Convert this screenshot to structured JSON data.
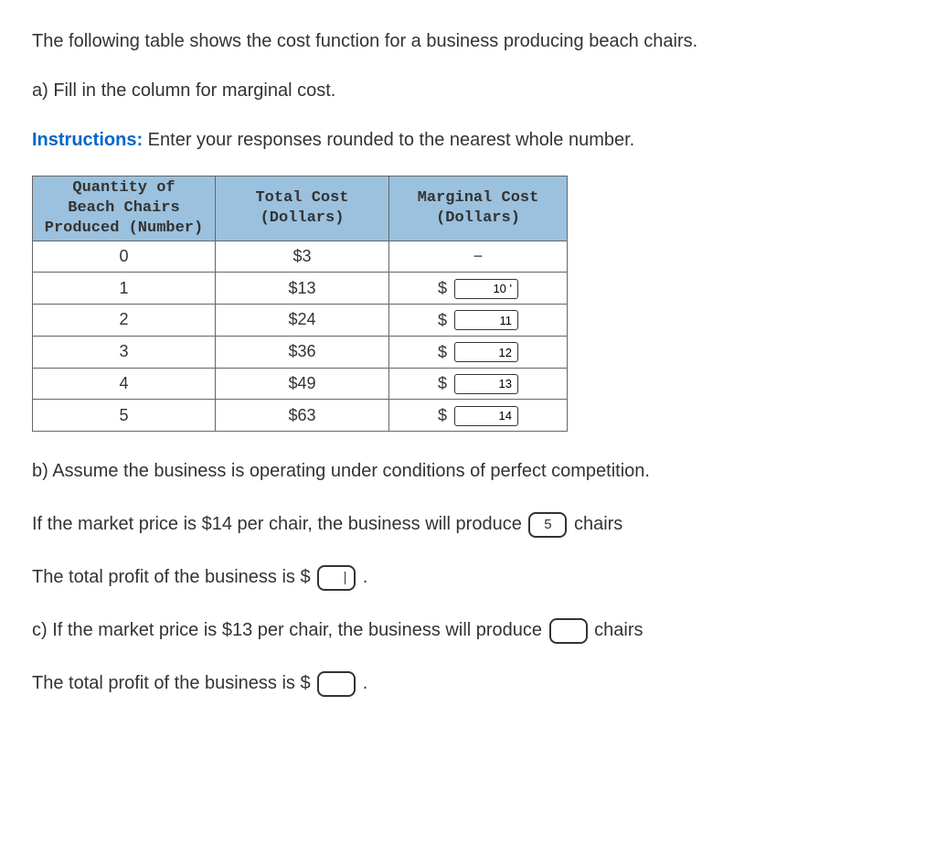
{
  "q_intro": "The following table shows the cost function for a business producing beach chairs.",
  "q_a": "a) Fill in the column for marginal cost.",
  "instr_label": "Instructions:",
  "instr_text": " Enter your responses rounded to the nearest whole number.",
  "table": {
    "headers": {
      "col1": "Quantity of\nBeach Chairs\nProduced (Number)",
      "col2": "Total Cost\n(Dollars)",
      "col3": "Marginal Cost\n(Dollars)"
    },
    "rows": [
      {
        "qty": "0",
        "tc": "$3",
        "mc_dash": "−",
        "mc_input": null
      },
      {
        "qty": "1",
        "tc": "$13",
        "mc_input": "10 '"
      },
      {
        "qty": "2",
        "tc": "$24",
        "mc_input": "11"
      },
      {
        "qty": "3",
        "tc": "$36",
        "mc_input": "12"
      },
      {
        "qty": "4",
        "tc": "$49",
        "mc_input": "13"
      },
      {
        "qty": "5",
        "tc": "$63",
        "mc_input": "14"
      }
    ]
  },
  "dollar": "$",
  "q_b_intro": "b) Assume the business is operating under conditions of perfect competition.",
  "q_b_line_pre": "If the market price is $14 per chair, the business will produce ",
  "q_b_line_post": " chairs",
  "q_b_chairs_value": "5",
  "q_b_profit_pre": "The total profit of the business is $ ",
  "q_b_profit_post": " .",
  "q_b_profit_value": "",
  "q_c_line_pre": "c) If the market price is $13 per chair, the business will produce ",
  "q_c_line_post": " chairs",
  "q_c_chairs_value": "",
  "q_c_profit_pre": "The total profit of the business is $ ",
  "q_c_profit_post": " .",
  "q_c_profit_value": "",
  "chart_data": {
    "type": "table",
    "title": "Cost function for beach chairs",
    "columns": [
      "Quantity of Beach Chairs Produced (Number)",
      "Total Cost (Dollars)",
      "Marginal Cost (Dollars)"
    ],
    "rows": [
      [
        0,
        3,
        null
      ],
      [
        1,
        13,
        10
      ],
      [
        2,
        24,
        11
      ],
      [
        3,
        36,
        12
      ],
      [
        4,
        49,
        13
      ],
      [
        5,
        63,
        14
      ]
    ]
  }
}
